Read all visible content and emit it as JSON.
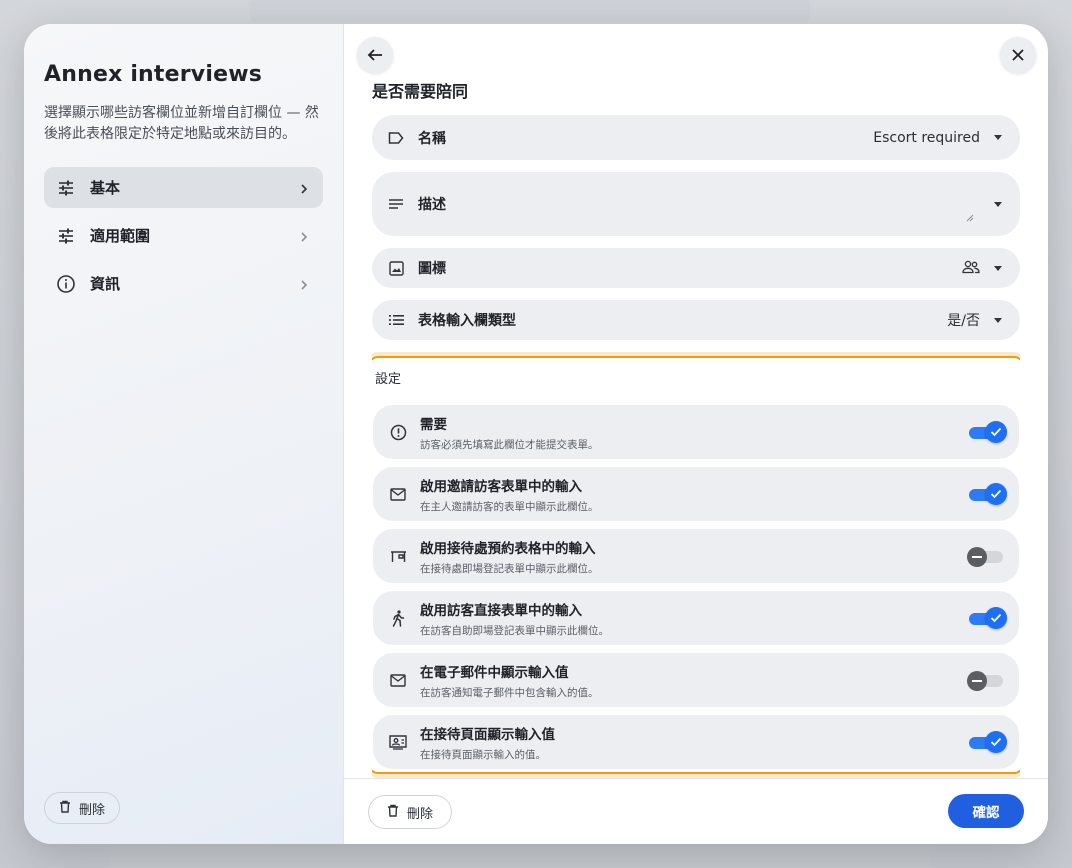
{
  "sidebar": {
    "title": "Annex interviews",
    "description": "選擇顯示哪些訪客欄位並新增自訂欄位 — 然後將此表格限定於特定地點或來訪目的。",
    "nav": [
      {
        "label": "基本",
        "icon": "tune-icon",
        "active": true
      },
      {
        "label": "適用範圍",
        "icon": "tune-icon",
        "active": false
      },
      {
        "label": "資訊",
        "icon": "info-icon",
        "active": false
      }
    ],
    "delete_label": "刪除"
  },
  "main": {
    "section_title": "是否需要陪同",
    "fields": {
      "name": {
        "label": "名稱",
        "value": "Escort required",
        "icon": "label-icon"
      },
      "description": {
        "label": "描述",
        "value": "",
        "icon": "notes-icon"
      },
      "icon": {
        "label": "圖標",
        "icon": "image-icon",
        "value_icon": "people-icon"
      },
      "input_type": {
        "label": "表格輸入欄類型",
        "value": "是/否",
        "icon": "list-icon"
      }
    },
    "settings": {
      "title": "設定",
      "items": [
        {
          "title": "需要",
          "subtitle": "訪客必須先填寫此欄位才能提交表單。",
          "icon": "alert-circle-icon",
          "enabled": true
        },
        {
          "title": "啟用邀請訪客表單中的輸入",
          "subtitle": "在主人邀請訪客的表單中顯示此欄位。",
          "icon": "mail-icon",
          "enabled": true
        },
        {
          "title": "啟用接待處預約表格中的輸入",
          "subtitle": "在接待處即場登記表單中顯示此欄位。",
          "icon": "reception-desk-icon",
          "enabled": false
        },
        {
          "title": "啟用訪客直接表單中的輸入",
          "subtitle": "在訪客自助即場登記表單中顯示此欄位。",
          "icon": "walking-person-icon",
          "enabled": true
        },
        {
          "title": "在電子郵件中顯示輸入值",
          "subtitle": "在訪客通知電子郵件中包含輸入的值。",
          "icon": "mail-icon",
          "enabled": false
        },
        {
          "title": "在接待頁面顯示輸入值",
          "subtitle": "在接待頁面顯示輸入的值。",
          "icon": "contact-card-icon",
          "enabled": true
        }
      ]
    }
  },
  "footer": {
    "delete_label": "刪除",
    "confirm_label": "確認"
  },
  "colors": {
    "accent": "#1f5fe0",
    "toggle_on": "#2d7cf6",
    "highlight_border": "#f29a12"
  }
}
